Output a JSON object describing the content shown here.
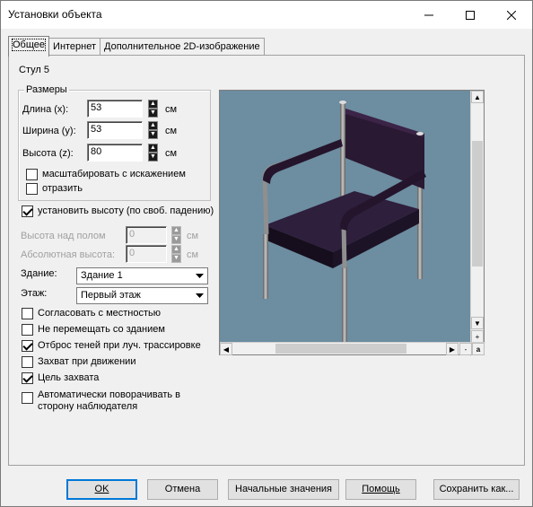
{
  "window": {
    "title": "Установки объекта"
  },
  "tabs": [
    {
      "label": "Общее",
      "active": true
    },
    {
      "label": "Интернет",
      "active": false
    },
    {
      "label": "Дополнительное 2D-изображение",
      "active": false
    }
  ],
  "object_name": "Стул 5",
  "sizes": {
    "group_title": "Размеры",
    "length_label": "Длина (x):",
    "length_value": "53",
    "width_label": "Ширина (y):",
    "width_value": "53",
    "height_label": "Высота (z):",
    "height_value": "80",
    "unit": "см",
    "scale_distort_label": "масштабировать с  искажением",
    "scale_distort_checked": false,
    "mirror_label": "отразить",
    "mirror_checked": false
  },
  "set_height_label": "установить высоту (по своб. падению)",
  "set_height_checked": true,
  "height_above_floor_label": "Высота над полом",
  "height_above_floor_value": "0",
  "absolute_height_label": "Абсолютная высота:",
  "absolute_height_value": "0",
  "building_label": "Здание:",
  "building_value": "Здание 1",
  "floor_label": "Этаж:",
  "floor_value": "Первый этаж",
  "options": [
    {
      "label": "Согласовать с местностью",
      "checked": false
    },
    {
      "label": "Не перемещать со зданием",
      "checked": false
    },
    {
      "label": "Отброс теней при луч. трассировке",
      "checked": true
    },
    {
      "label": "Захват при движении",
      "checked": false
    },
    {
      "label": "Цель захвата",
      "checked": true
    }
  ],
  "auto_rotate_label_line1": "Автоматически поворачивать в",
  "auto_rotate_label_line2": "сторону наблюдателя",
  "auto_rotate_checked": false,
  "preview": {
    "background_color": "#6d8da0",
    "zoom_plus": "+",
    "zoom_minus": "-",
    "zoom_a": "a"
  },
  "buttons": {
    "ok": "OK",
    "cancel": "Отмена",
    "defaults": "Начальные значения",
    "help": "Помощь",
    "save_as": "Сохранить как..."
  }
}
